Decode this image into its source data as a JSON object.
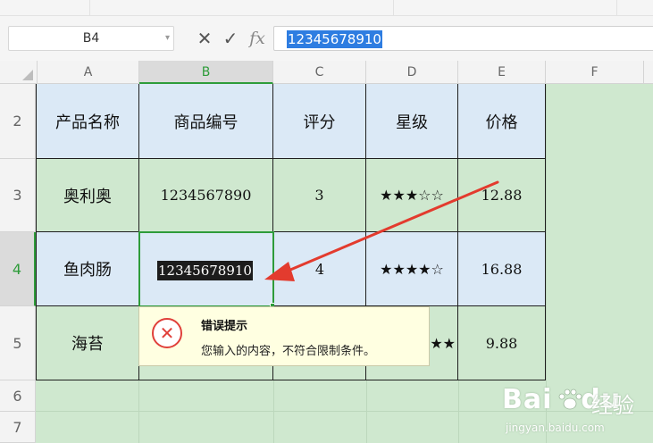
{
  "formula_bar": {
    "name_box": "B4",
    "cancel_icon": "✕",
    "confirm_icon": "✓",
    "fx_label": "fx",
    "value": "12345678910"
  },
  "columns": [
    "A",
    "B",
    "C",
    "D",
    "E",
    "F"
  ],
  "rows": [
    "2",
    "3",
    "4",
    "5",
    "6",
    "7"
  ],
  "table": {
    "headers": [
      "产品名称",
      "商品编号",
      "评分",
      "星级",
      "价格"
    ],
    "rows": [
      [
        "奥利奥",
        "1234567890",
        "3",
        "★★★☆☆",
        "12.88"
      ],
      [
        "鱼肉肠",
        "12345678910",
        "4",
        "★★★★☆",
        "16.88"
      ],
      [
        "海苔",
        "",
        "",
        "★★",
        "9.88"
      ]
    ]
  },
  "error_popup": {
    "icon": "x-circle-icon",
    "title": "错误提示",
    "message": "您输入的内容，不符合限制条件。"
  },
  "watermark": {
    "logo_prefix": "Bai",
    "logo_suffix": "du",
    "text": "经验",
    "url": "jingyan.baidu.com"
  },
  "colors": {
    "accent_green": "#2e9c3a",
    "cell_blue": "#dbe9f6",
    "cell_green": "#cfe8cf",
    "selection_blue": "#2e7de1",
    "annotation_red": "#e33b2e"
  }
}
